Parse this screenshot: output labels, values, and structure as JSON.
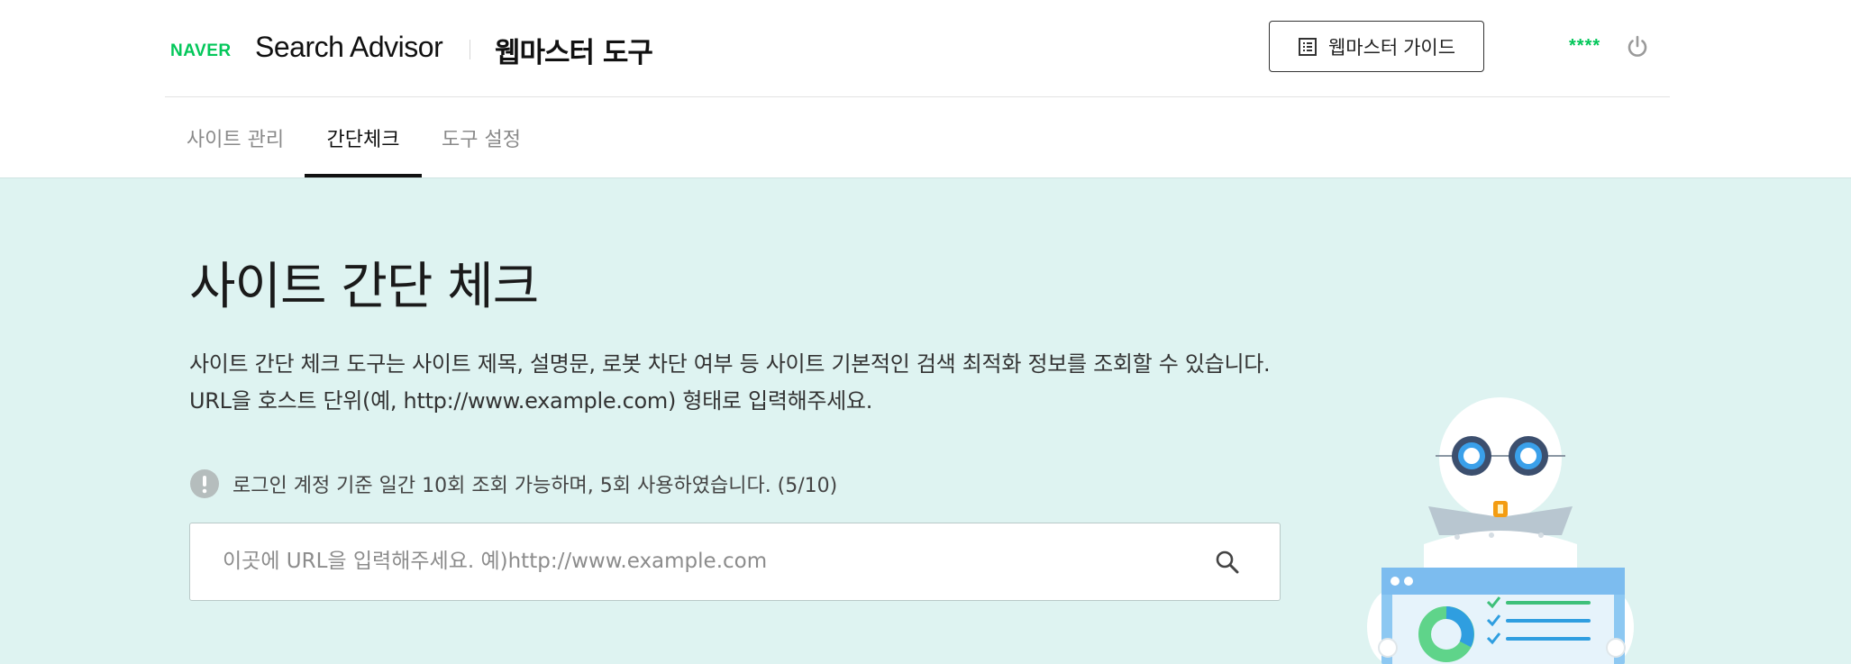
{
  "header": {
    "brand": "NAVER",
    "product": "Search Advisor",
    "tool_title": "웹마스터 도구",
    "guide_button_label": "웹마스터 가이드",
    "user_id": "****"
  },
  "tabs": [
    {
      "label": "사이트 관리",
      "active": false
    },
    {
      "label": "간단체크",
      "active": true
    },
    {
      "label": "도구 설정",
      "active": false
    }
  ],
  "main": {
    "title": "사이트 간단 체크",
    "description_line1": "사이트 간단 체크 도구는 사이트 제목, 설명문, 로봇 차단 여부 등 사이트 기본적인 검색 최적화 정보를 조회할 수 있습니다.",
    "description_line2": "URL을 호스트 단위(예, http://www.example.com) 형태로 입력해주세요.",
    "notice": "로그인 계정 기준 일간 10회 조회 가능하며, 5회 사용하였습니다. (5/10)",
    "search": {
      "placeholder": "이곳에 URL을 입력해주세요. 예)http://www.example.com",
      "value": ""
    }
  },
  "colors": {
    "brand_green": "#03c75a",
    "hero_background": "#def3f1",
    "active_tab_underline": "#111111"
  },
  "icons": [
    "guide-book-icon",
    "power-icon",
    "info-exclamation-icon",
    "search-icon",
    "robot-illustration"
  ]
}
